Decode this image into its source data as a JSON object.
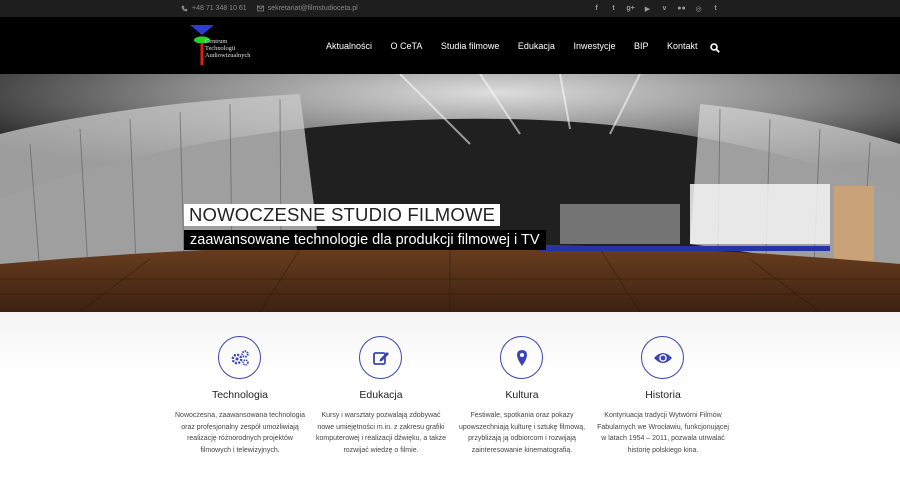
{
  "topbar": {
    "phone": "+48 71 348 10 61",
    "email": "sekretariat@filmstudioceta.pl",
    "social": [
      "facebook-icon",
      "twitter-icon",
      "google-plus-icon",
      "youtube-icon",
      "vimeo-icon",
      "flickr-icon",
      "instagram-icon",
      "tumblr-icon"
    ],
    "social_glyphs": [
      "f",
      "t",
      "g+",
      "▶",
      "v",
      "●●",
      "◎",
      "t"
    ]
  },
  "logo": {
    "line1": "Centrum",
    "line2": "Technologii",
    "line3": "Audiowizualnych"
  },
  "nav": {
    "items": [
      "Aktualności",
      "O CeTA",
      "Studia filmowe",
      "Edukacja",
      "Inwestycje",
      "BIP",
      "Kontakt"
    ]
  },
  "hero": {
    "title": "NOWOCZESNE STUDIO FILMOWE",
    "subtitle": "zaawansowane technologie dla produkcji filmowej i TV"
  },
  "features": [
    {
      "icon": "gears-icon",
      "title": "Technologia",
      "desc": "Nowoczesna, zaawansowana technologia oraz profesjonalny zespół umożliwiają realizację różnorodnych projektów filmowych i telewizyjnych."
    },
    {
      "icon": "edit-icon",
      "title": "Edukacja",
      "desc": "Kursy i warsztaty pozwalają zdobywać nowe umiejętności m.in. z zakresu grafiki komputerowej i realizacji dźwięku, a także rozwijać wiedzę o filmie."
    },
    {
      "icon": "map-marker-icon",
      "title": "Kultura",
      "desc": "Festiwale, spotkania oraz pokazy upowszechniają kulturę i sztukę filmową, przybliżają ją odbiorcom i rozwijają zainteresowanie kinematografią."
    },
    {
      "icon": "eye-icon",
      "title": "Historia",
      "desc": "Kontynuacja tradycji Wytwórni Filmów Fabularnych we Wrocławiu, funkcjonującej w latach 1954 – 2011, pozwala utrwalać historię polskiego kina."
    }
  ],
  "colors": {
    "accent": "#3a44b6",
    "topbar_bg": "#1e1e1e",
    "header_bg": "#000000"
  }
}
